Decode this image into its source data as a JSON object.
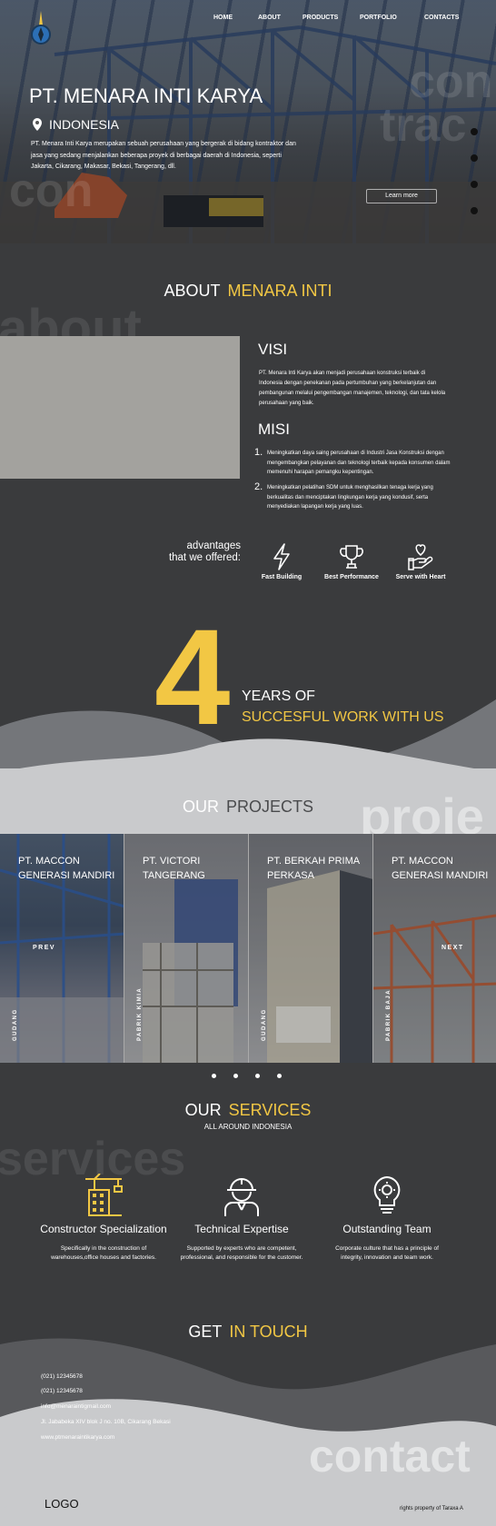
{
  "nav": {
    "items": [
      "HOME",
      "ABOUT",
      "PRODUCTS",
      "PORTFOLIO",
      "CONTACTS"
    ]
  },
  "hero": {
    "title": "PT. MENARA INTI KARYA",
    "location": "INDONESIA",
    "description": "PT. Menara Inti Karya merupakan sebuah perusahaan yang bergerak di bidang kontraktor dan jasa yang sedang menjalankan beberapa proyek di berbagai daerah di Indonesia, seperti Jakarta, Cikarang, Makasar, Bekasi, Tangerang, dll.",
    "button": "Learn more",
    "ghost": [
      "con",
      "trac",
      "con"
    ]
  },
  "about": {
    "heading_white": "ABOUT",
    "heading_yellow": "MENARA INTI",
    "ghost": "about",
    "visi_title": "VISI",
    "visi_text": "PT. Menara Inti Karya akan menjadi perusahaan konstruksi terbaik di Indonesia dengan penekanan pada pertumbuhan yang berkelanjutan dan pembangunan melalui pengembangan manajemen, teknologi, dan tata kelola perusahaan yang baik.",
    "misi_title": "MISI",
    "misi": [
      "Meningkatkan daya saing perusahaan di Industri Jasa Konstruksi dengan mengembangkan pelayanan dan teknologi terbaik kepada konsumen dalam memenuhi harapan pemangku kepentingan.",
      "Meningkatkan pelatihan SDM untuk menghasilkan tenaga kerja yang berkualitas dan menciptakan lingkungan kerja yang kondusif, serta menyediakan lapangan kerja yang luas."
    ],
    "misi_numbers": [
      "1.",
      "2."
    ],
    "advantages_line1": "advantages",
    "advantages_line2": "that we offered:",
    "advantages": [
      "Fast Building",
      "Best Performance",
      "Serve with Heart"
    ]
  },
  "years": {
    "number": "4",
    "line1": "YEARS OF",
    "line2": "SUCCESFUL WORK WITH US"
  },
  "projects": {
    "heading_white": "OUR",
    "heading_gray": "PROJECTS",
    "ghost": "proje",
    "prev": "PREV",
    "next": "NEXT",
    "items": [
      {
        "title": "PT. MACCON GENERASI MANDIRI",
        "vertical": "GUDANG"
      },
      {
        "title": "PT. VICTORI TANGERANG",
        "vertical": "PABRIK KIMIA"
      },
      {
        "title": "PT. BERKAH PRIMA PERKASA",
        "vertical": "GUDANG"
      },
      {
        "title": "PT. MACCON GENERASI MANDIRI",
        "vertical": "PABRIK BAJA"
      }
    ]
  },
  "services": {
    "heading_white": "OUR",
    "heading_yellow": "SERVICES",
    "subtitle": "ALL AROUND INDONESIA",
    "ghost": "services",
    "items": [
      {
        "title": "Constructor Specialization",
        "text": "Specifically in the construction of warehouses,office houses and factories."
      },
      {
        "title": "Technical Expertise",
        "text": "Supported by experts who are competent, professional, and responsible for the customer."
      },
      {
        "title": "Outstanding Team",
        "text": "Corporate culture that has a principle of integrity, innovation and team work."
      }
    ]
  },
  "contact": {
    "heading_white": "GET",
    "heading_yellow": "IN TOUCH",
    "ghost": "contact",
    "lines": [
      "(021) 12345678",
      "(021) 12345678",
      "info@menaraintigmail.com",
      "Jl. Jababeka XIV blok J no. 10B, Cikarang Bekasi",
      "www.ptmenaraintikarya.com"
    ]
  },
  "footer": {
    "logo": "LOGO",
    "rights": "rights property of Taraxa A"
  },
  "colors": {
    "accent": "#f2c744",
    "dark": "#3a3b3d",
    "light": "#c9cacc"
  }
}
